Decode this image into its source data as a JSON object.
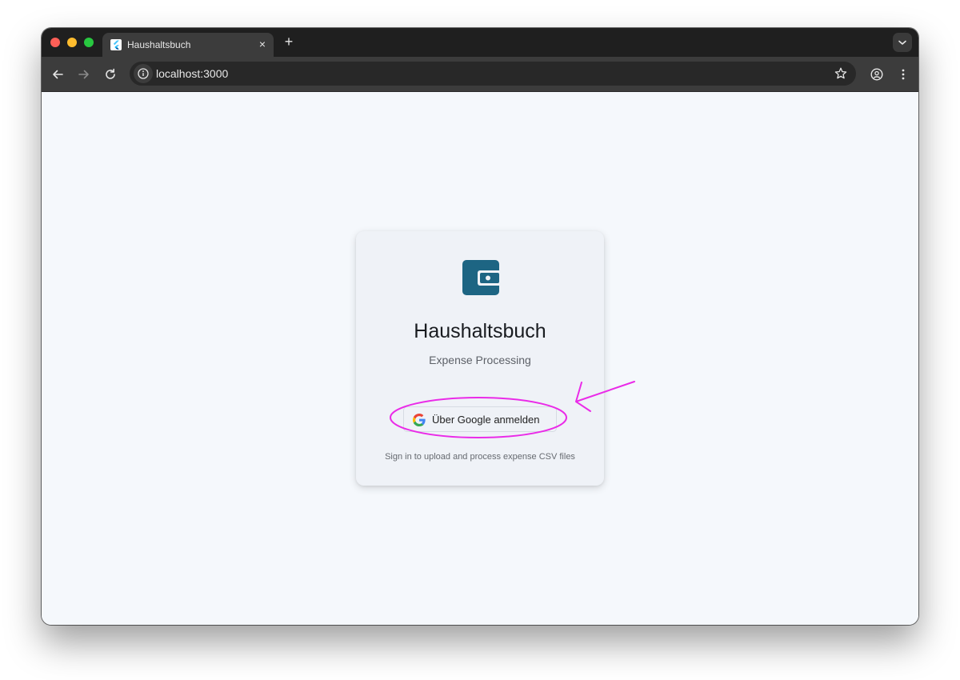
{
  "browser": {
    "tab_title": "Haushaltsbuch",
    "url": "localhost:3000",
    "tab_close_symbol": "×",
    "new_tab_symbol": "+"
  },
  "login": {
    "app_title": "Haushaltsbuch",
    "subtitle": "Expense Processing",
    "google_button_label": "Über Google anmelden",
    "hint": "Sign in to upload and process expense CSV files",
    "icon": "wallet-icon"
  },
  "colors": {
    "accent": "#1d6583",
    "background": "#f5f8fc",
    "card": "#eff2f7",
    "annotation": "#ea2be8"
  }
}
